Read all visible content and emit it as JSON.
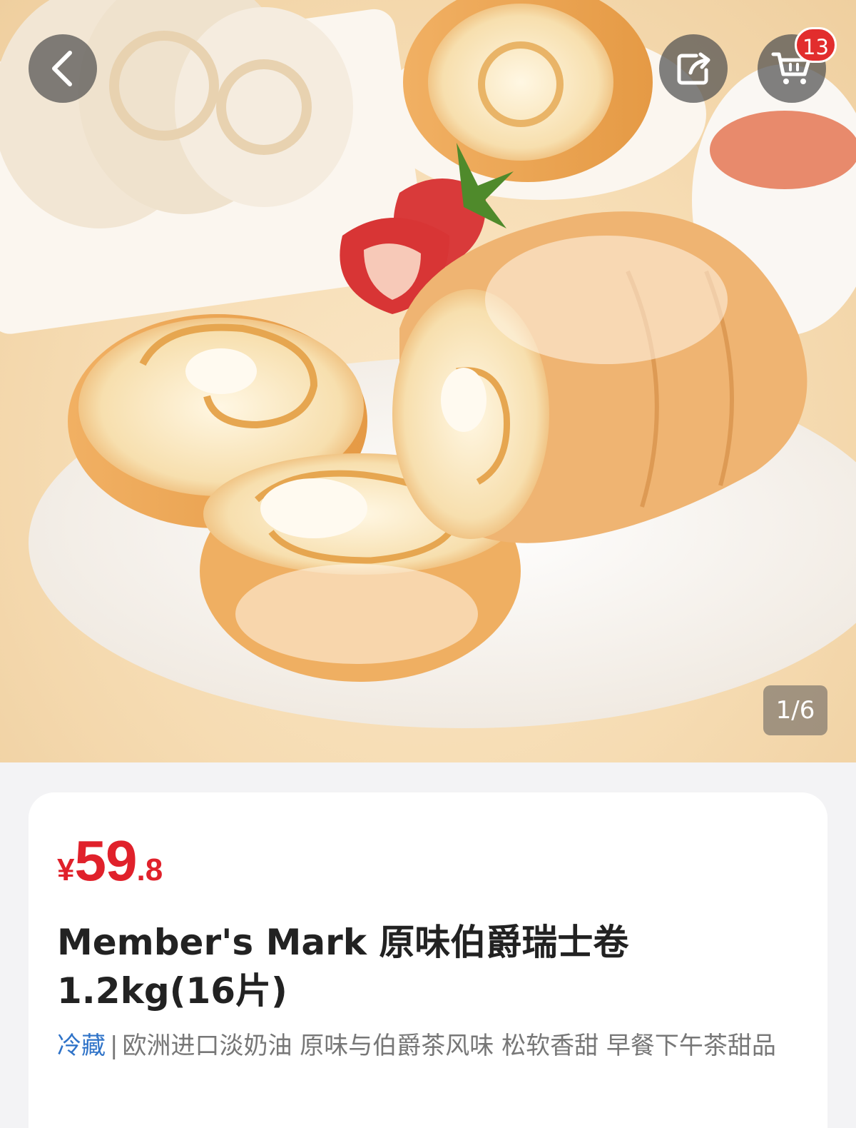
{
  "header": {
    "back_icon": "chevron-left-icon",
    "share_icon": "share-icon",
    "cart_icon": "cart-icon",
    "cart_count": "13"
  },
  "gallery": {
    "pager": "1/6"
  },
  "product": {
    "price_currency": "¥",
    "price_integer": "59",
    "price_decimal": ".8",
    "title": "Member's Mark 原味伯爵瑞士卷 1.2kg(16片)",
    "tag": "冷藏",
    "separator": "|",
    "description": "欧洲进口淡奶油 原味与伯爵茶风味 松软香甜 早餐下午茶甜品"
  },
  "colors": {
    "price": "#e0212b",
    "tag": "#2f73c8",
    "badge": "#e22d2d"
  }
}
